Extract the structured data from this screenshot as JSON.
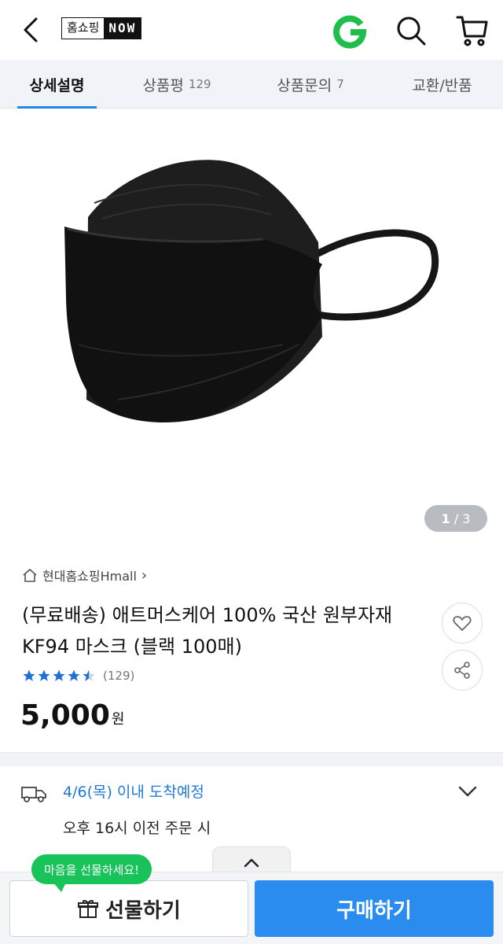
{
  "header": {
    "brand_ko": "홈쇼핑",
    "brand_now": "NOW",
    "icons": [
      "back-icon",
      "g-logo",
      "search-icon",
      "cart-icon"
    ],
    "accent_green": "#1fbe4b"
  },
  "tabs": [
    {
      "label": "상세설명",
      "count": "",
      "active": true
    },
    {
      "label": "상품평",
      "count": "129",
      "active": false
    },
    {
      "label": "상품문의",
      "count": "7",
      "active": false
    },
    {
      "label": "교환/반품",
      "count": "",
      "active": false
    }
  ],
  "hero": {
    "pager_current": "1",
    "pager_sep": " / ",
    "pager_total": "3"
  },
  "product": {
    "store": "현대홈쇼핑Hmall",
    "store_chevron": "›",
    "title": "(무료배송) 애트머스케어 100% 국산 원부자재 KF94 마스크 (블랙 100매)",
    "rating": 4.5,
    "review_count": "(129)",
    "price": "5,000",
    "price_unit": "원"
  },
  "delivery": {
    "eta": "4/6(목) 이내 도착예정",
    "cutoff": "오후 16시 이전 주문 시"
  },
  "bottom": {
    "tooltip": "마음을 선물하세요!",
    "gift_label": "선물하기",
    "buy_label": "구매하기",
    "buy_color": "#2a8cef"
  }
}
